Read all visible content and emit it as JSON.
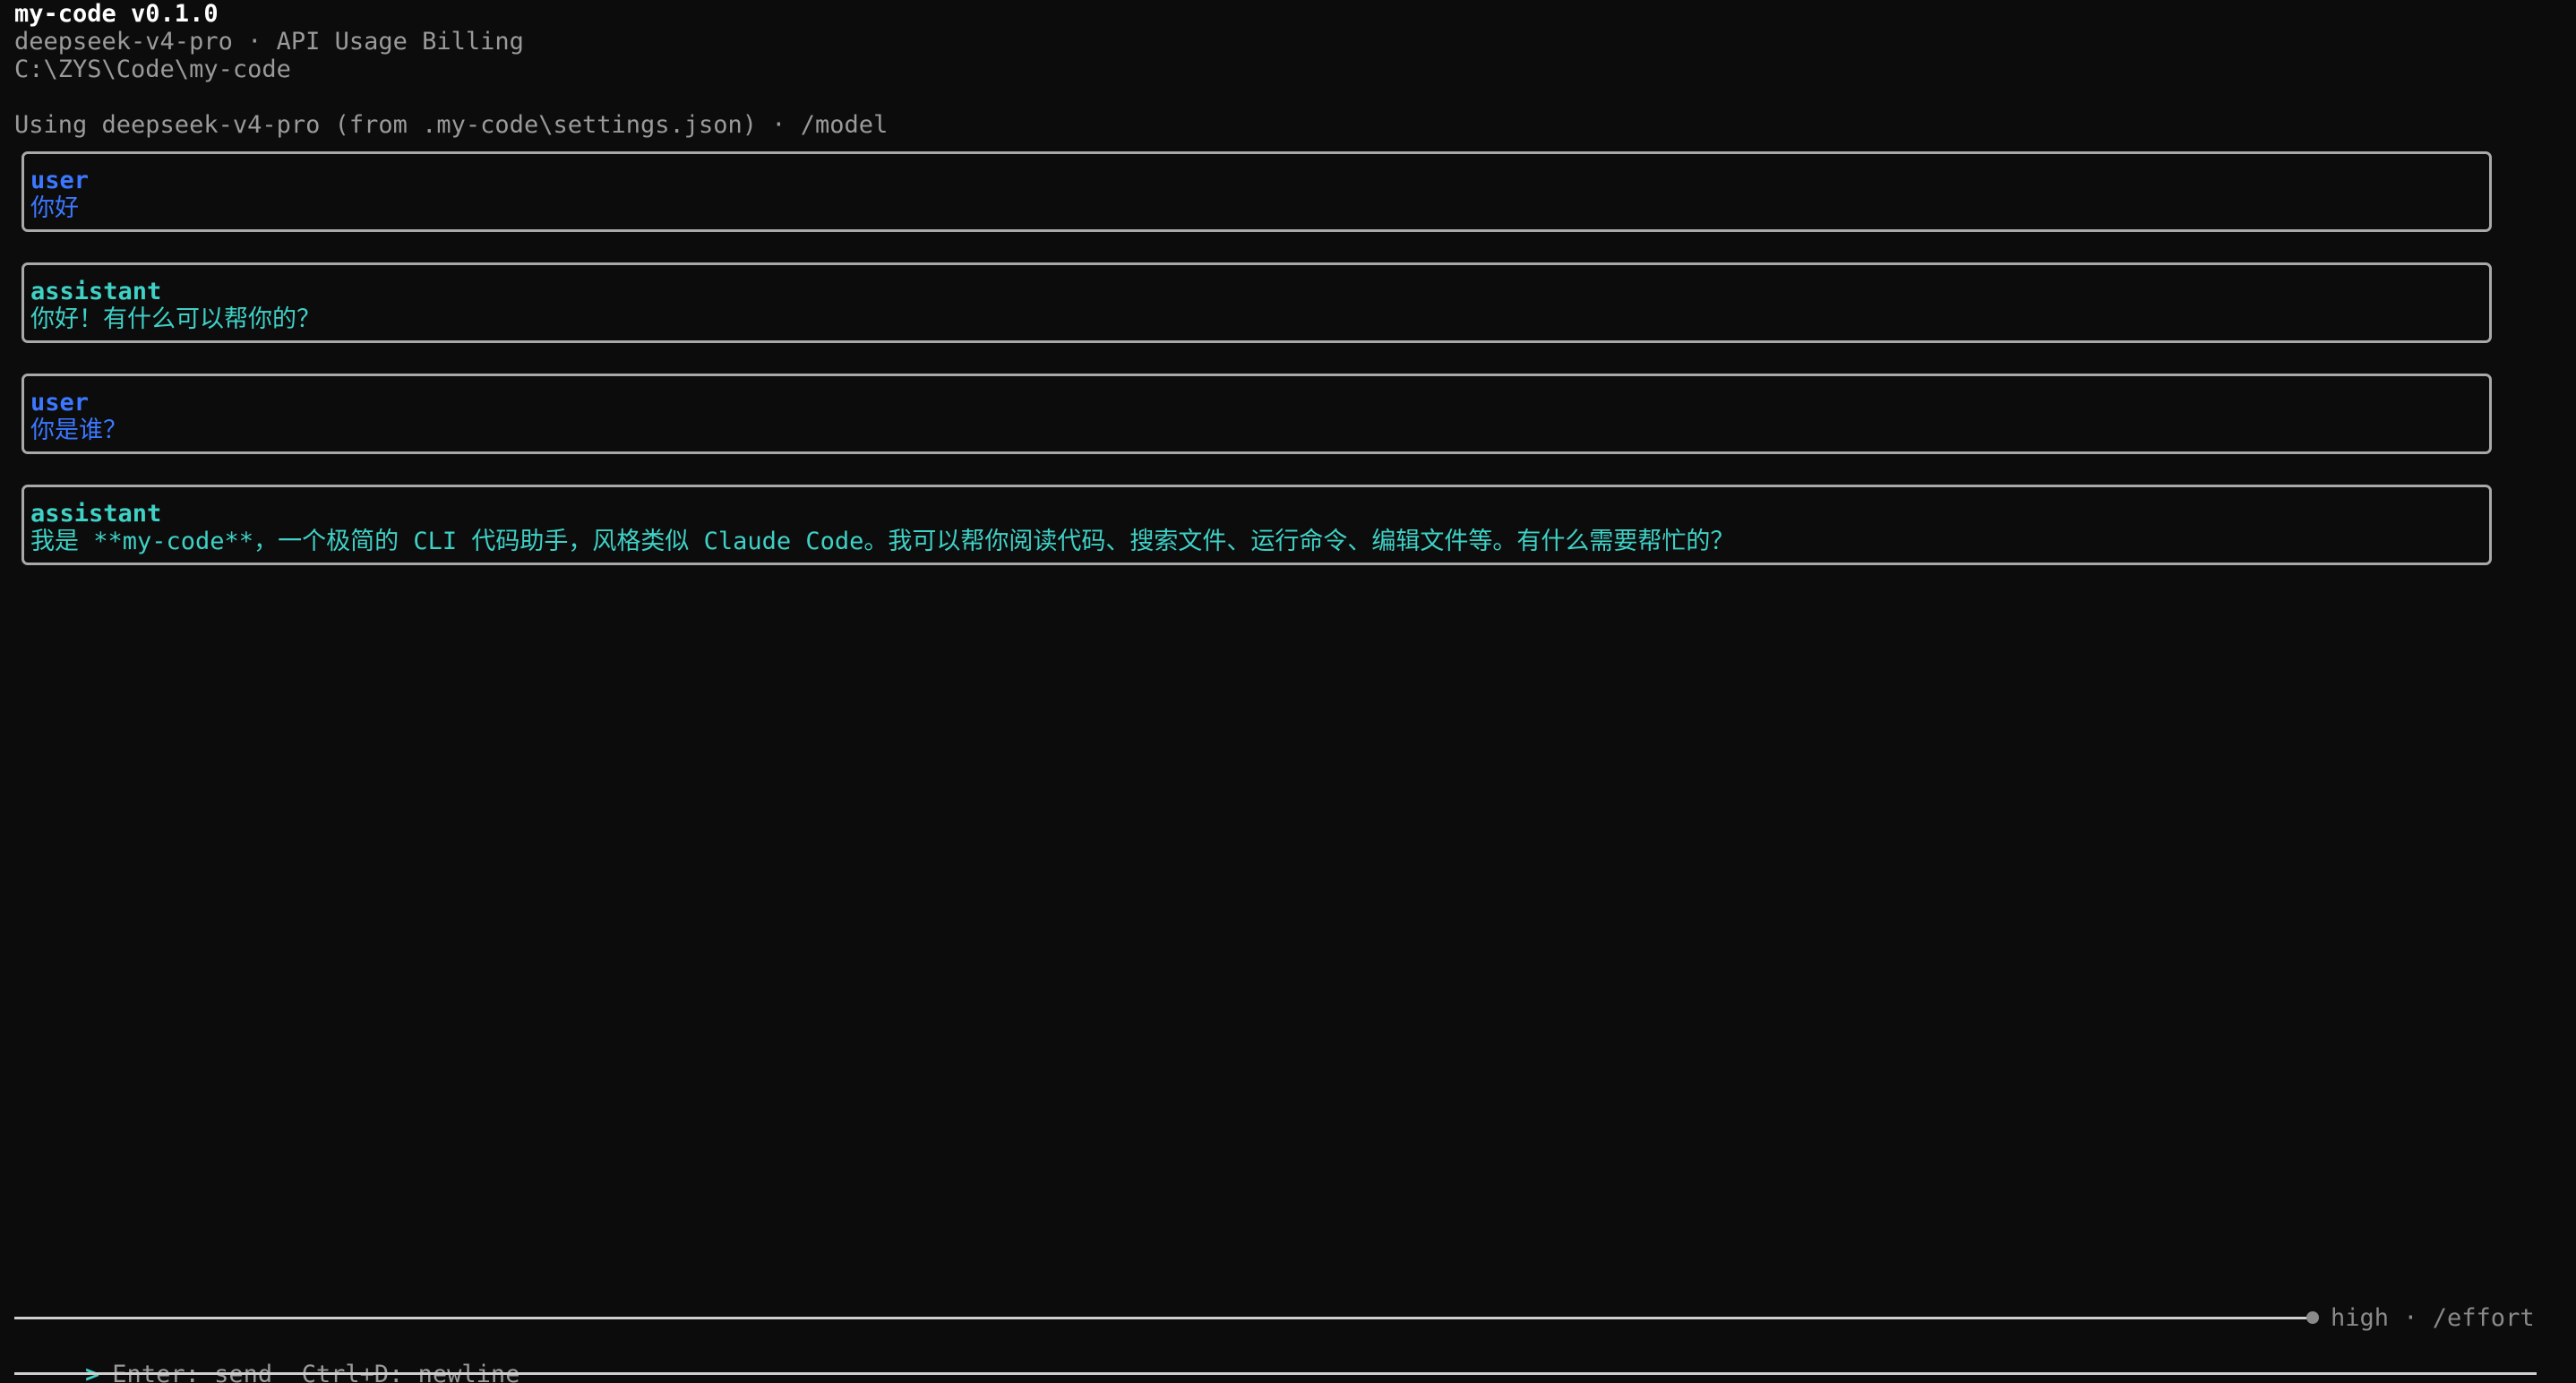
{
  "app": {
    "title": "my-code v0.1.0",
    "subtitle": "deepseek-v4-pro · API Usage Billing",
    "cwd": "C:\\ZYS\\Code\\my-code"
  },
  "notice": "Using deepseek-v4-pro (from .my-code\\settings.json) · /model",
  "messages": [
    {
      "role": "user",
      "text": "你好"
    },
    {
      "role": "assistant",
      "text": "你好！有什么可以帮你的？"
    },
    {
      "role": "user",
      "text": "你是谁？"
    },
    {
      "role": "assistant",
      "text": "我是 **my-code**，一个极简的 CLI 代码助手，风格类似 Claude Code。我可以帮你阅读代码、搜索文件、运行命令、编辑文件等。有什么需要帮忙的？"
    }
  ],
  "status": {
    "effort": "high · /effort"
  },
  "input": {
    "prompt": ">",
    "hint": "Enter: send  Ctrl+D: newline"
  },
  "colors": {
    "background": "#0c0c0c",
    "user": "#3b78ff",
    "assistant": "#3fd1c6",
    "dim": "#9a9a9a",
    "border": "#a9a9a9"
  },
  "icons": {
    "effort_indicator": "dot-icon"
  }
}
